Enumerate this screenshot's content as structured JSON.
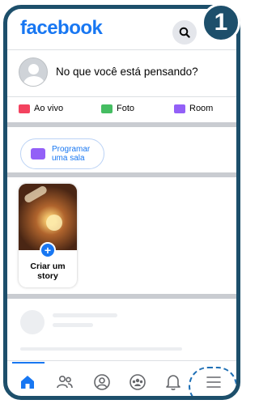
{
  "step_number": "1",
  "header": {
    "logo": "facebook",
    "search_icon": "search-icon"
  },
  "composer": {
    "placeholder": "No que você está pensando?"
  },
  "actions": [
    {
      "label": "Ao vivo",
      "icon": "live-video-icon",
      "color": "#f3425f"
    },
    {
      "label": "Foto",
      "icon": "photo-icon",
      "color": "#45bd62"
    },
    {
      "label": "Room",
      "icon": "room-icon",
      "color": "#9360f7"
    }
  ],
  "room_chip": {
    "line1": "Programar",
    "line2": "uma sala"
  },
  "story": {
    "line1": "Criar um",
    "line2": "story",
    "plus": "+"
  },
  "nav": {
    "active": "home",
    "items": [
      "home-icon",
      "friends-icon",
      "profile-icon",
      "groups-icon",
      "notifications-icon",
      "menu-icon"
    ]
  },
  "colors": {
    "brand": "#1877f2",
    "frame": "#1d4f6b",
    "highlight": "#1e6fb5"
  }
}
